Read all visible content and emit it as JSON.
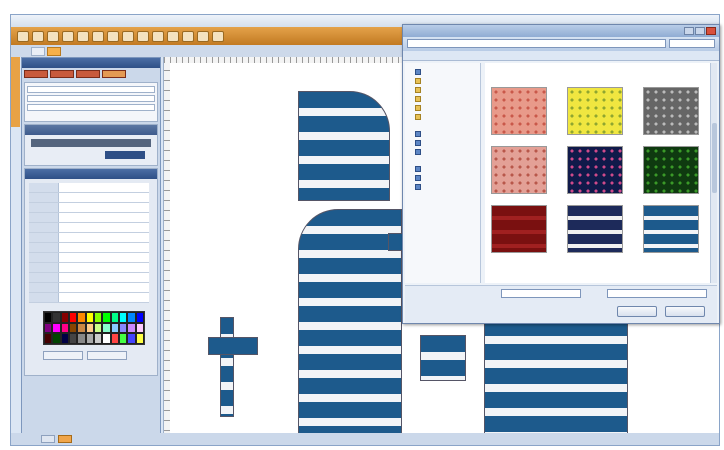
{
  "app": {
    "menu": [
      "",
      "",
      "",
      "",
      "",
      "",
      "",
      ""
    ],
    "doc_tabs": [
      "",
      ""
    ],
    "status_tabs": [
      "",
      ""
    ]
  },
  "left_panel": {
    "title": "",
    "section2_title": "",
    "section3_title": "",
    "palette_buttons": [
      "",
      ""
    ]
  },
  "dialog": {
    "title": "",
    "address": "",
    "library_title": "",
    "nav_items": [
      "",
      "",
      "",
      "",
      "",
      "",
      "",
      "",
      "",
      "",
      "",
      ""
    ],
    "thumbnails": [
      {
        "label": "",
        "bg": "#e89a8a",
        "pattern": "#c9584a"
      },
      {
        "label": "",
        "bg": "#f0e640",
        "pattern": "#8fa630"
      },
      {
        "label": "",
        "bg": "#666666",
        "pattern": "#bbbbbb"
      },
      {
        "label": "",
        "bg": "#e3a096",
        "pattern": "#b8574a"
      },
      {
        "label": "",
        "bg": "#101a4a",
        "pattern": "#d04a8a"
      },
      {
        "label": "",
        "bg": "#0f3a10",
        "pattern": "#3a9a28"
      },
      {
        "label": "",
        "bg": "#7a1010",
        "pattern": "#a02020"
      },
      {
        "label": "",
        "bg": "#1d2a5a",
        "pattern": "#f0f0f0"
      },
      {
        "label": "",
        "bg": "#1d5a8c",
        "pattern": "#f2f4f7"
      }
    ],
    "filename_label": "",
    "filename_value": "",
    "filetype_value": "",
    "buttons": [
      "",
      ""
    ]
  },
  "colors": {
    "accent": "#e8a245",
    "navy": "#1d5a8c",
    "panel": "#cbd8ea"
  }
}
